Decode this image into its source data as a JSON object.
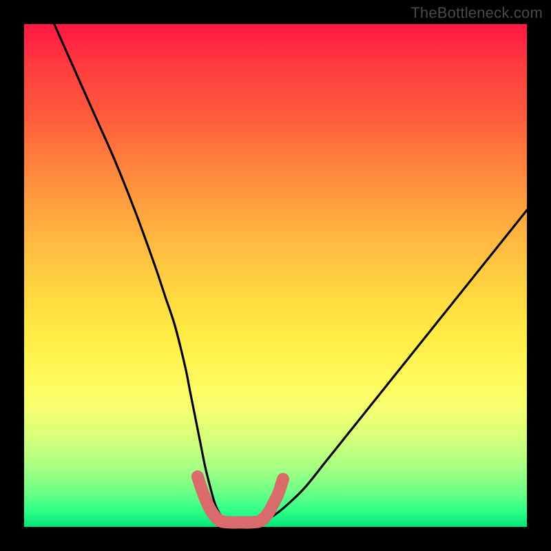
{
  "watermark": "TheBottleneck.com",
  "chart_data": {
    "type": "line",
    "title": "",
    "xlabel": "",
    "ylabel": "",
    "xlim": [
      0,
      100
    ],
    "ylim": [
      0,
      100
    ],
    "series": [
      {
        "name": "curve",
        "color": "#000000",
        "x": [
          6,
          10,
          14,
          18,
          22,
          26,
          28,
          30,
          32,
          33,
          34,
          35,
          36,
          37,
          38,
          39,
          40,
          41,
          42,
          44,
          46,
          48,
          50,
          53,
          56,
          60,
          64,
          68,
          72,
          76,
          80,
          84,
          88,
          92,
          96,
          100
        ],
        "y": [
          100,
          91,
          82,
          73,
          63,
          52,
          46,
          40,
          32,
          27,
          22,
          17,
          12,
          8,
          4.5,
          2.5,
          1.5,
          1.1,
          1.0,
          1.0,
          1.1,
          1.5,
          2.5,
          5,
          8,
          13,
          18,
          23,
          28,
          33,
          38,
          43,
          48,
          53,
          58,
          63
        ]
      },
      {
        "name": "marker-band",
        "color": "#d96b6b",
        "x": [
          34.5,
          35.5,
          36.5,
          37.5,
          39,
          41,
          43,
          45,
          47,
          48.5,
          49.5,
          50.5,
          51.5
        ],
        "y": [
          10,
          7,
          4.5,
          2.7,
          1.2,
          0.9,
          0.9,
          0.9,
          1.2,
          2.7,
          4.5,
          6.5,
          9.5
        ]
      }
    ]
  },
  "colors": {
    "background": "#000000",
    "curve_stroke": "#000000",
    "marker_stroke": "#d96b6b",
    "watermark": "#4a4a4a"
  }
}
